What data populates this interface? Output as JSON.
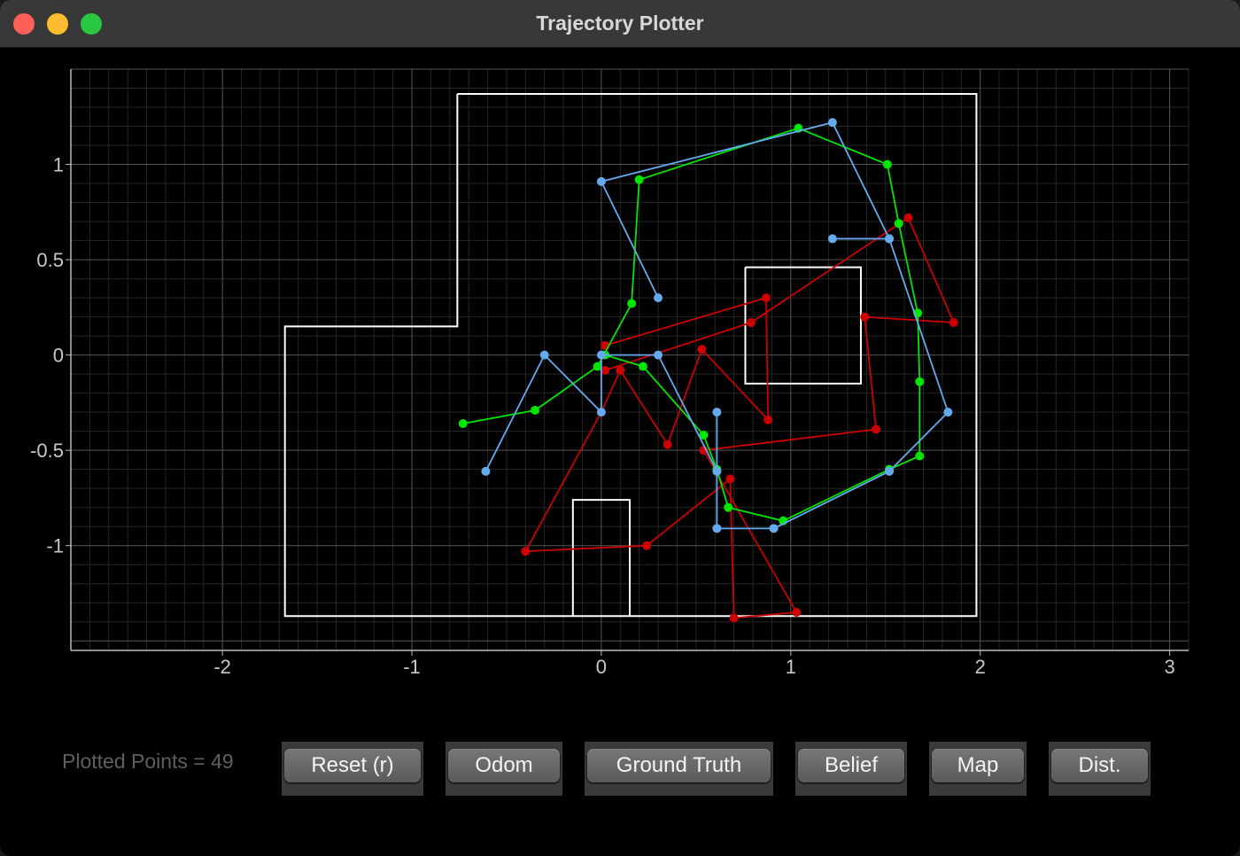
{
  "window": {
    "title": "Trajectory Plotter"
  },
  "status": {
    "plotted_points": "Plotted Points = 49"
  },
  "buttons": [
    {
      "id": "reset",
      "label": "Reset (r)"
    },
    {
      "id": "odom",
      "label": "Odom"
    },
    {
      "id": "ground-truth",
      "label": "Ground Truth"
    },
    {
      "id": "belief",
      "label": "Belief"
    },
    {
      "id": "map",
      "label": "Map"
    },
    {
      "id": "dist",
      "label": "Dist."
    }
  ],
  "colors": {
    "background": "#000000",
    "odom": "#cc0000",
    "ground_truth": "#00e600",
    "belief": "#66aaee",
    "map": "#ffffff"
  },
  "chart_data": {
    "type": "line",
    "title": "",
    "xlabel": "",
    "ylabel": "",
    "xlim": [
      -2.8,
      3.1
    ],
    "ylim": [
      -1.55,
      1.5
    ],
    "xticks": [
      "-2",
      "-1",
      "0",
      "1",
      "2",
      "3"
    ],
    "yticks": [
      "1",
      "0.5",
      "0",
      "-0.5",
      "-1"
    ],
    "grid": true,
    "map": [
      [
        [
          -0.76,
          1.37
        ],
        [
          1.98,
          1.37
        ],
        [
          1.98,
          -1.37
        ],
        [
          -1.67,
          -1.37
        ],
        [
          -1.67,
          0.15
        ],
        [
          -0.76,
          0.15
        ],
        [
          -0.76,
          1.37
        ]
      ],
      [
        [
          0.76,
          0.46
        ],
        [
          1.37,
          0.46
        ],
        [
          1.37,
          -0.15
        ],
        [
          0.76,
          -0.15
        ],
        [
          0.76,
          0.46
        ]
      ],
      [
        [
          -0.15,
          -1.37
        ],
        [
          -0.15,
          -0.76
        ],
        [
          0.15,
          -0.76
        ],
        [
          0.15,
          -1.37
        ]
      ]
    ],
    "series": [
      {
        "key": "odom",
        "points": [
          [
            0.02,
            0.05
          ],
          [
            0.87,
            0.3
          ],
          [
            0.88,
            -0.34
          ],
          [
            0.53,
            0.03
          ],
          [
            0.35,
            -0.47
          ],
          [
            0.1,
            -0.08
          ],
          [
            0.0,
            -0.3
          ],
          [
            -0.4,
            -1.03
          ],
          [
            0.24,
            -1.0
          ],
          [
            0.68,
            -0.65
          ],
          [
            0.7,
            -1.38
          ],
          [
            1.03,
            -1.35
          ],
          [
            0.54,
            -0.5
          ],
          [
            1.45,
            -0.39
          ],
          [
            1.39,
            0.2
          ],
          [
            1.86,
            0.17
          ],
          [
            1.62,
            0.72
          ],
          [
            0.79,
            0.17
          ],
          [
            0.02,
            -0.08
          ]
        ]
      },
      {
        "key": "ground_truth",
        "points": [
          [
            -0.73,
            -0.36
          ],
          [
            -0.35,
            -0.29
          ],
          [
            -0.02,
            -0.06
          ],
          [
            0.16,
            0.27
          ],
          [
            0.2,
            0.92
          ],
          [
            1.04,
            1.19
          ],
          [
            1.51,
            1.0
          ],
          [
            1.57,
            0.69
          ],
          [
            1.67,
            0.22
          ],
          [
            1.68,
            -0.14
          ],
          [
            1.68,
            -0.53
          ],
          [
            1.52,
            -0.6
          ],
          [
            0.96,
            -0.87
          ],
          [
            0.67,
            -0.8
          ],
          [
            0.61,
            -0.6
          ],
          [
            0.54,
            -0.42
          ],
          [
            0.22,
            -0.06
          ],
          [
            0.02,
            0.0
          ]
        ]
      },
      {
        "key": "belief",
        "points": [
          [
            -0.61,
            -0.61
          ],
          [
            -0.3,
            0.0
          ],
          [
            0.0,
            -0.3
          ],
          [
            0.0,
            0.0
          ],
          [
            0.3,
            0.0
          ],
          [
            0.61,
            -0.61
          ],
          [
            0.61,
            -0.3
          ],
          [
            0.61,
            -0.91
          ],
          [
            0.91,
            -0.91
          ],
          [
            1.52,
            -0.61
          ],
          [
            1.83,
            -0.3
          ],
          [
            1.52,
            0.61
          ],
          [
            1.22,
            0.61
          ],
          [
            1.52,
            0.61
          ],
          [
            1.22,
            1.22
          ],
          [
            0.0,
            0.91
          ],
          [
            0.3,
            0.3
          ]
        ]
      }
    ]
  }
}
